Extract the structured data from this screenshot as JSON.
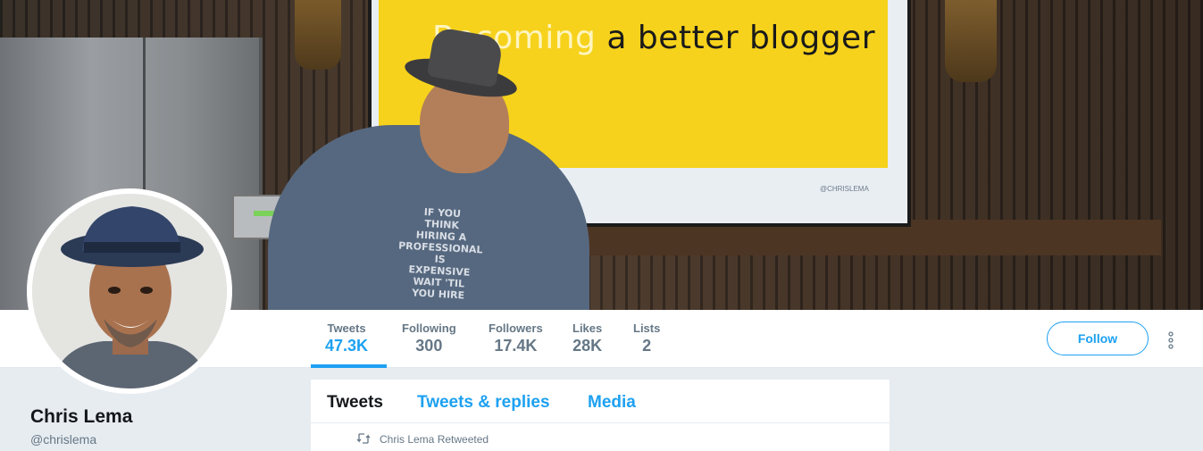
{
  "banner": {
    "slide_title_faded": "Becoming",
    "slide_title": " a better blogger",
    "slide_credit": "@CHRISLEMA",
    "shirt_text": [
      "IF YOU",
      "THINK",
      "HIRING A",
      "PROFESSIONAL",
      "IS",
      "EXPENSIVE",
      "WAIT 'TIL",
      "YOU HIRE"
    ]
  },
  "profile": {
    "name": "Chris Lema",
    "handle": "@chrislema"
  },
  "stats": [
    {
      "label": "Tweets",
      "value": "47.3K",
      "active": true
    },
    {
      "label": "Following",
      "value": "300",
      "active": false
    },
    {
      "label": "Followers",
      "value": "17.4K",
      "active": false
    },
    {
      "label": "Likes",
      "value": "28K",
      "active": false
    },
    {
      "label": "Lists",
      "value": "2",
      "active": false
    }
  ],
  "actions": {
    "follow_label": "Follow",
    "more_icon": "vertical-ellipsis-icon"
  },
  "timeline": {
    "tabs": [
      "Tweets",
      "Tweets & replies",
      "Media"
    ],
    "active_tab": "Tweets",
    "retweet_context": "Chris Lema Retweeted",
    "retweet_icon": "retweet-icon"
  },
  "colors": {
    "accent": "#1da1f2",
    "text_primary": "#14171a",
    "text_secondary": "#657786",
    "page_bg": "#e6ecf0"
  }
}
